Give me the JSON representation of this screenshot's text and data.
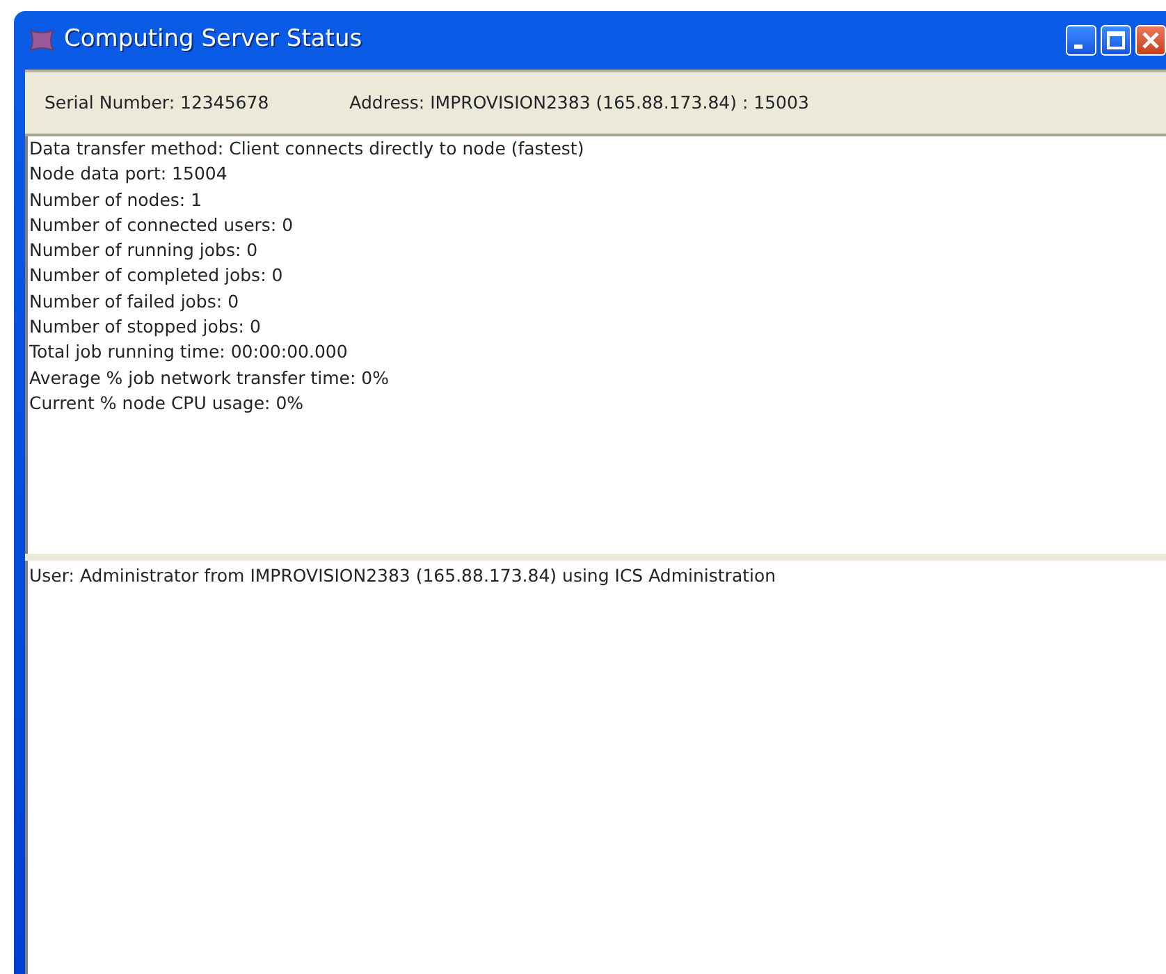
{
  "window": {
    "title": "Computing Server Status"
  },
  "info_bar": {
    "serial": "Serial Number: 12345678",
    "address": "Address: IMPROVISION2383 (165.88.173.84) : 15003"
  },
  "status_lines": [
    "Data transfer method: Client connects directly to node (fastest)",
    "Node data port: 15004",
    "Number of nodes: 1",
    "Number of connected users: 0",
    "Number of running jobs: 0",
    "Number of completed jobs: 0",
    "Number of failed jobs: 0",
    "Number of stopped jobs: 0",
    "Total job running time: 00:00:00.000",
    "Average % job network transfer time: 0%",
    "Current % node CPU usage: 0%"
  ],
  "user_lines": [
    "User: Administrator from IMPROVISION2383 (165.88.173.84) using ICS Administration"
  ]
}
